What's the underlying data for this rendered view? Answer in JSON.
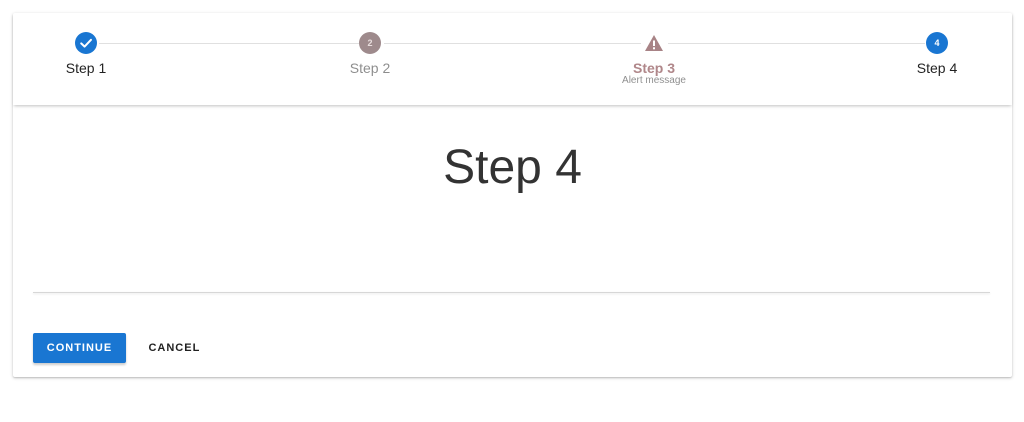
{
  "stepper": {
    "steps": [
      {
        "label": "Step 1",
        "state": "complete",
        "icon": "check-icon"
      },
      {
        "label": "Step 2",
        "state": "inactive",
        "number": "2"
      },
      {
        "label": "Step 3",
        "sublabel": "Alert message",
        "state": "error",
        "icon": "warning-icon"
      },
      {
        "label": "Step 4",
        "state": "active",
        "number": "4"
      }
    ]
  },
  "content": {
    "title": "Step 4"
  },
  "actions": {
    "continue_label": "CONTINUE",
    "cancel_label": "CANCEL"
  },
  "colors": {
    "primary": "#1976d2",
    "inactive": "#9e8a8c",
    "error": "#b0878a",
    "connector": "#e0e0e0"
  }
}
